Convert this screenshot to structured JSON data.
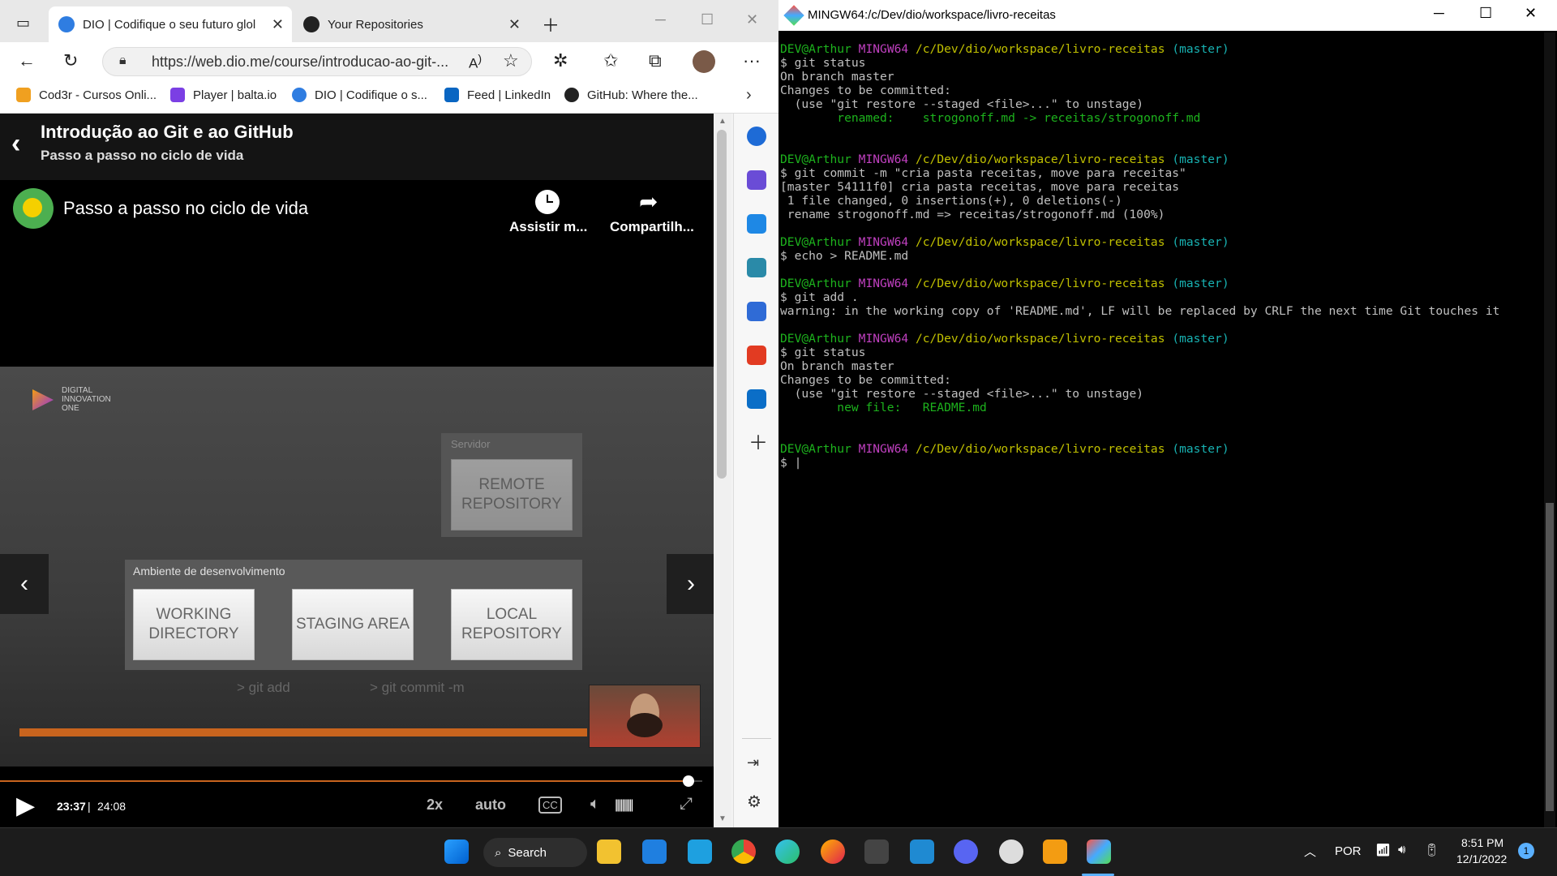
{
  "browser": {
    "tabs": [
      {
        "label": "DIO | Codifique o seu futuro glol"
      },
      {
        "label": "Your Repositories"
      }
    ],
    "url": "https://web.dio.me/course/introducao-ao-git-...",
    "favorites": [
      "Cod3r - Cursos Onli...",
      "Player | balta.io",
      "DIO | Codifique o s...",
      "Feed | LinkedIn",
      "GitHub: Where the..."
    ],
    "page": {
      "title": "Introdução ao Git e ao GitHub",
      "subtitle": "Passo a passo no ciclo de vida",
      "video_title": "Passo a passo no ciclo de vida",
      "watch_later": "Assistir m...",
      "share": "Compartilh...",
      "slide": {
        "brand": [
          "DIGITAL",
          "INNOVATION",
          "ONE"
        ],
        "server_label": "Servidor",
        "remote": "REMOTE REPOSITORY",
        "env_label": "Ambiente de desenvolvimento",
        "working": "WORKING DIRECTORY",
        "staging": "STAGING AREA",
        "local": "LOCAL REPOSITORY",
        "cmd_add": "> git add",
        "cmd_commit": "> git commit -m"
      },
      "player": {
        "current": "23:37",
        "separator": "|",
        "duration": "24:08",
        "speed": "2x",
        "quality": "auto",
        "progress": 0.98
      }
    }
  },
  "terminal": {
    "title": "MINGW64:/c/Dev/dio/workspace/livro-receitas",
    "prompt_user": "DEV@Arthur",
    "prompt_env": "MINGW64",
    "prompt_path": "/c/Dev/dio/workspace/livro-receitas",
    "prompt_branch": "(master)",
    "blocks": [
      {
        "cmd": "$ git status",
        "out": [
          "On branch master",
          "Changes to be committed:",
          "  (use \"git restore --staged <file>...\" to unstage)"
        ],
        "green": "        renamed:    strogonoff.md -> receitas/strogonoff.md"
      },
      {
        "cmd": "$ git commit -m \"cria pasta receitas, move para receitas\"",
        "out": [
          "[master 54111f0] cria pasta receitas, move para receitas",
          " 1 file changed, 0 insertions(+), 0 deletions(-)",
          " rename strogonoff.md => receitas/strogonoff.md (100%)"
        ]
      },
      {
        "cmd": "$ echo > README.md",
        "out": []
      },
      {
        "cmd": "$ git add .",
        "out": [
          "warning: in the working copy of 'README.md', LF will be replaced by CRLF the next time Git touches it"
        ]
      },
      {
        "cmd": "$ git status",
        "out": [
          "On branch master",
          "Changes to be committed:",
          "  (use \"git restore --staged <file>...\" to unstage)"
        ],
        "green": "        new file:   README.md"
      },
      {
        "cmd": "$ |",
        "out": []
      }
    ]
  },
  "taskbar": {
    "search": "Search",
    "lang": "POR",
    "time": "8:51 PM",
    "date": "12/1/2022",
    "notifications": "1"
  }
}
